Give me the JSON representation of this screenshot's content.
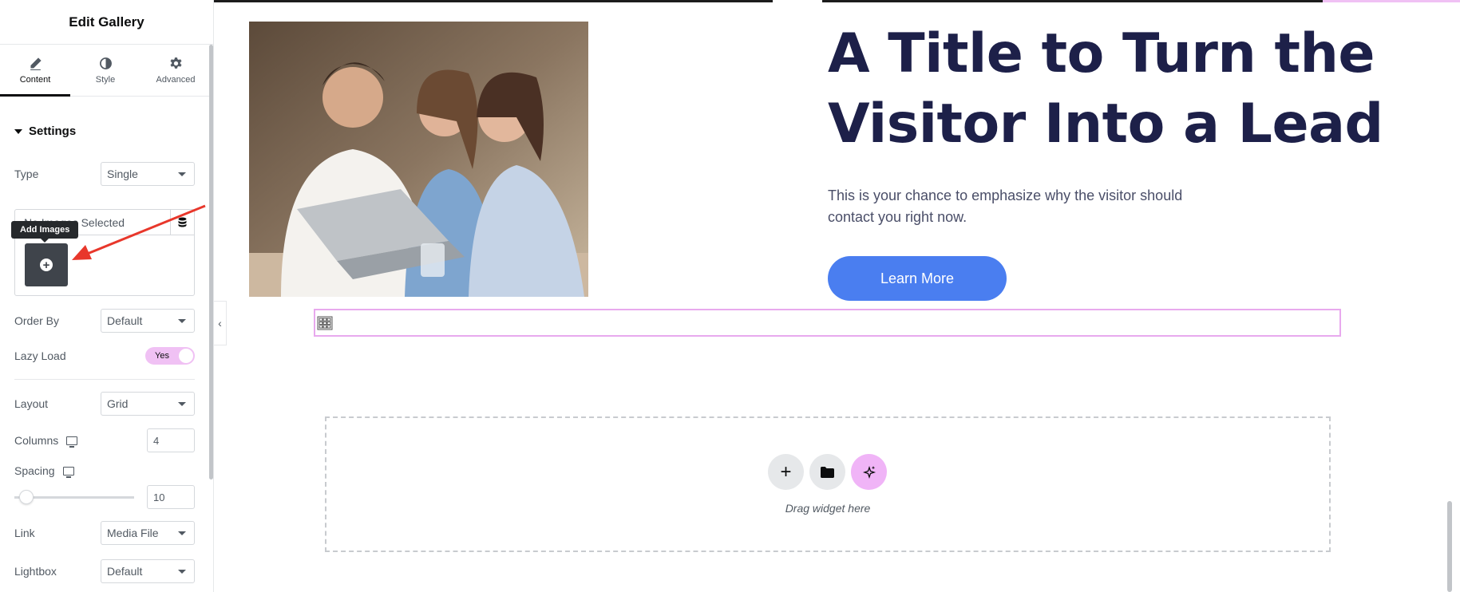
{
  "panel": {
    "title": "Edit Gallery",
    "tabs": [
      {
        "label": "Content",
        "icon": "pencil-icon"
      },
      {
        "label": "Style",
        "icon": "contrast-icon"
      },
      {
        "label": "Advanced",
        "icon": "gear-icon"
      }
    ],
    "section_title": "Settings",
    "type": {
      "label": "Type",
      "value": "Single"
    },
    "gallery": {
      "placeholder": "No Images Selected",
      "tooltip": "Add Images"
    },
    "order_by": {
      "label": "Order By",
      "value": "Default"
    },
    "lazy_load": {
      "label": "Lazy Load",
      "value": "Yes"
    },
    "layout": {
      "label": "Layout",
      "value": "Grid"
    },
    "columns": {
      "label": "Columns",
      "value": "4"
    },
    "spacing": {
      "label": "Spacing",
      "value": "10"
    },
    "link": {
      "label": "Link",
      "value": "Media File"
    },
    "lightbox": {
      "label": "Lightbox",
      "value": "Default"
    }
  },
  "canvas": {
    "hero": {
      "title": "A Title to Turn the Visitor Into a Lead",
      "text": "This is your chance to emphasize why the visitor should contact you right now.",
      "button": "Learn More"
    },
    "drop_zone": {
      "label": "Drag widget here"
    }
  },
  "colors": {
    "accent_pink": "#f0c1f4",
    "button_blue": "#4a7ef0",
    "title_navy": "#1d2049"
  }
}
